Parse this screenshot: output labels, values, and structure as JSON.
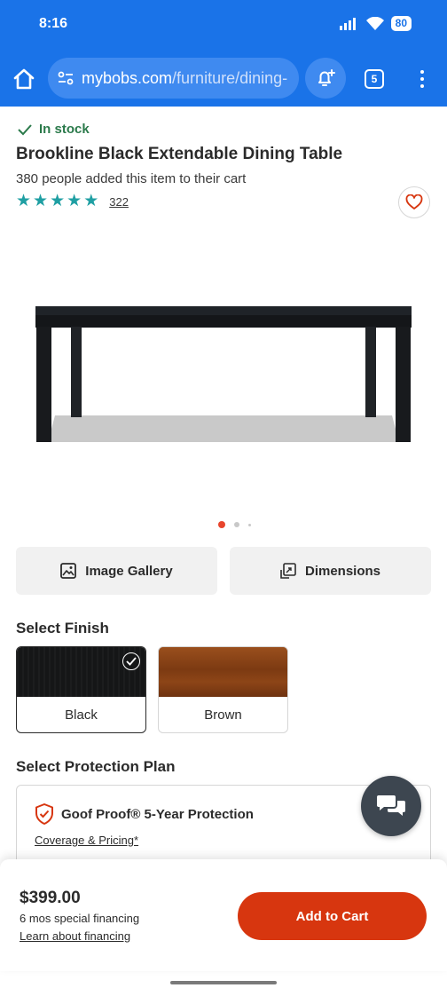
{
  "status_bar": {
    "time": "8:16",
    "battery": "80"
  },
  "browser": {
    "url_domain": "mybobs.com",
    "url_path": "/furniture/dining-",
    "tab_count": "5"
  },
  "product": {
    "stock": "In stock",
    "title": "Brookline Black Extendable Dining Table",
    "cart_count": "380 people added this item to their cart",
    "rating": 5,
    "review_count": "322",
    "carousel_index": 1,
    "carousel_total": 3
  },
  "buttons": {
    "gallery": "Image Gallery",
    "dimensions": "Dimensions"
  },
  "finish": {
    "title": "Select Finish",
    "options": [
      {
        "label": "Black",
        "color": "#151617",
        "selected": true
      },
      {
        "label": "Brown",
        "color": "#8a4418",
        "selected": false
      }
    ]
  },
  "protection": {
    "title": "Select Protection Plan",
    "plan_name": "Goof Proof® 5-Year Protection",
    "link": "Coverage & Pricing*"
  },
  "purchase": {
    "price": "$399.00",
    "financing": "6 mos special financing",
    "learn": "Learn about financing",
    "add_to_cart": "Add to Cart"
  },
  "colors": {
    "browser_blue": "#1a73e8",
    "accent_red": "#d7360f",
    "star_teal": "#1f9fa3",
    "stock_green": "#2b7a4b"
  }
}
